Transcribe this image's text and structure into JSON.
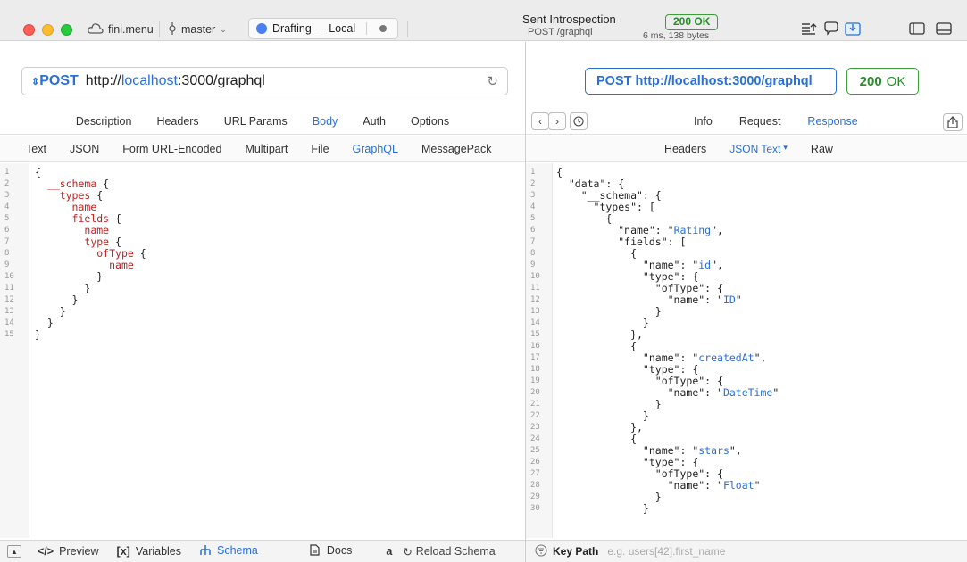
{
  "titlebar": {
    "project": "fini.menu",
    "branch": "master",
    "draft": "Drafting — Local",
    "request_title": "Sent Introspection",
    "request_subtitle": "POST /graphql",
    "status_badge": "200 OK",
    "meta": "6 ms, 138 bytes"
  },
  "request": {
    "method": "POST",
    "url_prefix": "http://",
    "url_host": "localhost",
    "url_rest": ":3000/graphql",
    "tabs": [
      "Description",
      "Headers",
      "URL Params",
      "Body",
      "Auth",
      "Options"
    ],
    "active_tab": "Body",
    "body_types": [
      "Text",
      "JSON",
      "Form URL-Encoded",
      "Multipart",
      "File",
      "GraphQL",
      "MessagePack"
    ],
    "active_body_type": "GraphQL",
    "query_lines": [
      "{",
      "  __schema {",
      "    types {",
      "      name",
      "      fields {",
      "        name",
      "        type {",
      "          ofType {",
      "            name",
      "          }",
      "        }",
      "      }",
      "    }",
      "  }",
      "}"
    ]
  },
  "bottom_bar": {
    "preview": "Preview",
    "variables": "Variables",
    "schema": "Schema",
    "docs": "Docs",
    "a_label": "a",
    "reload_schema": "Reload Schema",
    "preview_glyph": "</>",
    "variables_glyph": "[x]"
  },
  "response": {
    "url_label": "POST http://localhost:3000/graphql",
    "status_code": "200",
    "status_text": "OK",
    "tabs": [
      "Info",
      "Request",
      "Response"
    ],
    "active_tab": "Response",
    "subtabs": [
      "Headers",
      "JSON Text",
      "Raw"
    ],
    "active_subtab": "JSON Text",
    "json_lines": [
      "{",
      "  \"data\": {",
      "    \"__schema\": {",
      "      \"types\": [",
      "        {",
      "          \"name\": \"Rating\",",
      "          \"fields\": [",
      "            {",
      "              \"name\": \"id\",",
      "              \"type\": {",
      "                \"ofType\": {",
      "                  \"name\": \"ID\"",
      "                }",
      "              }",
      "            },",
      "            {",
      "              \"name\": \"createdAt\",",
      "              \"type\": {",
      "                \"ofType\": {",
      "                  \"name\": \"DateTime\"",
      "                }",
      "              }",
      "            },",
      "            {",
      "              \"name\": \"stars\",",
      "              \"type\": {",
      "                \"ofType\": {",
      "                  \"name\": \"Float\"",
      "                }",
      "              }"
    ]
  },
  "keypath": {
    "label": "Key Path",
    "placeholder": "e.g. users[42].first_name"
  },
  "colors": {
    "accent": "#2a6fd6",
    "success": "#2b8a2b",
    "keyword": "#c21f1f"
  }
}
